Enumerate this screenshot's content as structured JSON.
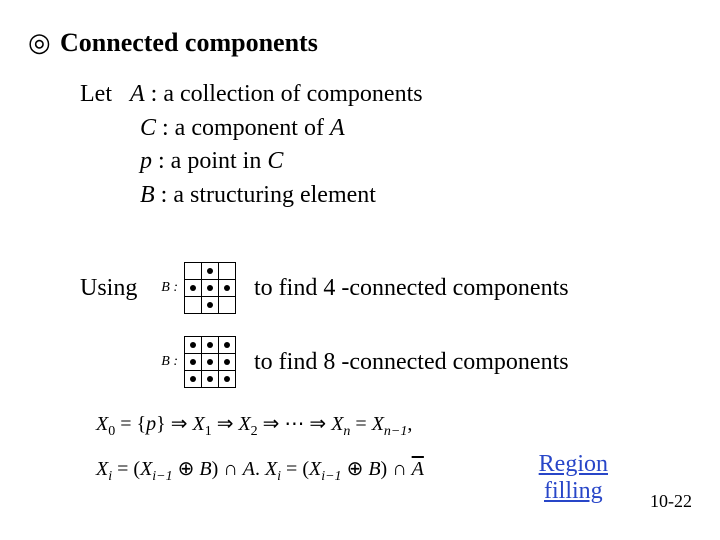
{
  "header": {
    "bullet": "◎",
    "title": "Connected components"
  },
  "definitions": {
    "let": "Let",
    "A_var": "A",
    "A_desc": " : a collection of components",
    "C_var": "C",
    "C_desc": " : a component of ",
    "C_of": "A",
    "p_var": "p",
    "p_desc": " : a point in ",
    "p_of": "C",
    "B_var": "B",
    "B_desc": " : a structuring element"
  },
  "using": {
    "label": "Using",
    "B_label": "B :",
    "text4": "to find 4 -connected components",
    "text8": "to find 8 -connected components"
  },
  "formula": {
    "line1_a": "X",
    "line1_b": " = {",
    "line1_c": "p",
    "line1_d": "} ⇒ ",
    "line1_e": "X",
    "line1_f": " ⇒ ",
    "line1_g": "X",
    "line1_h": " ⇒ ⋯ ⇒ ",
    "line1_i": "X",
    "line1_j": " = ",
    "line1_k": "X",
    "line1_l": ",",
    "sub0": "0",
    "sub1": "1",
    "sub2": "2",
    "subn": "n",
    "subnm1": "n−1",
    "line2_a": "X",
    "subi": "i",
    "line2_b": " = (",
    "line2_c": "X",
    "subim1": "i−1",
    "line2_d": " ⊕ ",
    "line2_e": "B",
    "line2_f": ") ∩ ",
    "line2_g": "A",
    "line2_h": ".",
    "line2_sep": "   ",
    "line2_i": "X",
    "line2_j": " = (",
    "line2_k": "X",
    "line2_l": " ⊕ ",
    "line2_m": "B",
    "line2_n": ") ∩ ",
    "line2_o": "A",
    "line2_p": "  "
  },
  "link": {
    "text1": "Region",
    "text2": "filling"
  },
  "footer": {
    "page": "10-22"
  }
}
